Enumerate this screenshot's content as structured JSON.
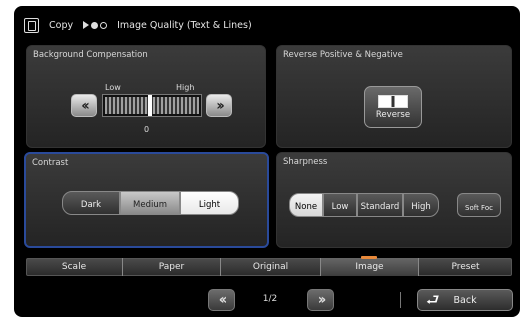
{
  "header": {
    "copy_label": "Copy",
    "title": "Image Quality (Text & Lines)"
  },
  "background_compensation": {
    "title": "Background Compensation",
    "low_label": "Low",
    "high_label": "High",
    "value": "0",
    "level": 0.5
  },
  "reverse": {
    "title": "Reverse Positive & Negative",
    "button_label": "Reverse"
  },
  "contrast": {
    "title": "Contrast",
    "options": [
      "Dark",
      "Medium",
      "Light"
    ],
    "selected": "Light"
  },
  "sharpness": {
    "title": "Sharpness",
    "options": [
      "None",
      "Low",
      "Standard",
      "High"
    ],
    "extra_option": "Soft Foc",
    "selected": "None"
  },
  "tabs": [
    "Scale",
    "Paper",
    "Original",
    "Image",
    "Preset"
  ],
  "active_tab": "Image",
  "pager": {
    "page": "1/2"
  },
  "back_label": "Back",
  "colors": {
    "focus_border": "#2a4a9a",
    "active_tab_indicator": "#e8893a"
  }
}
